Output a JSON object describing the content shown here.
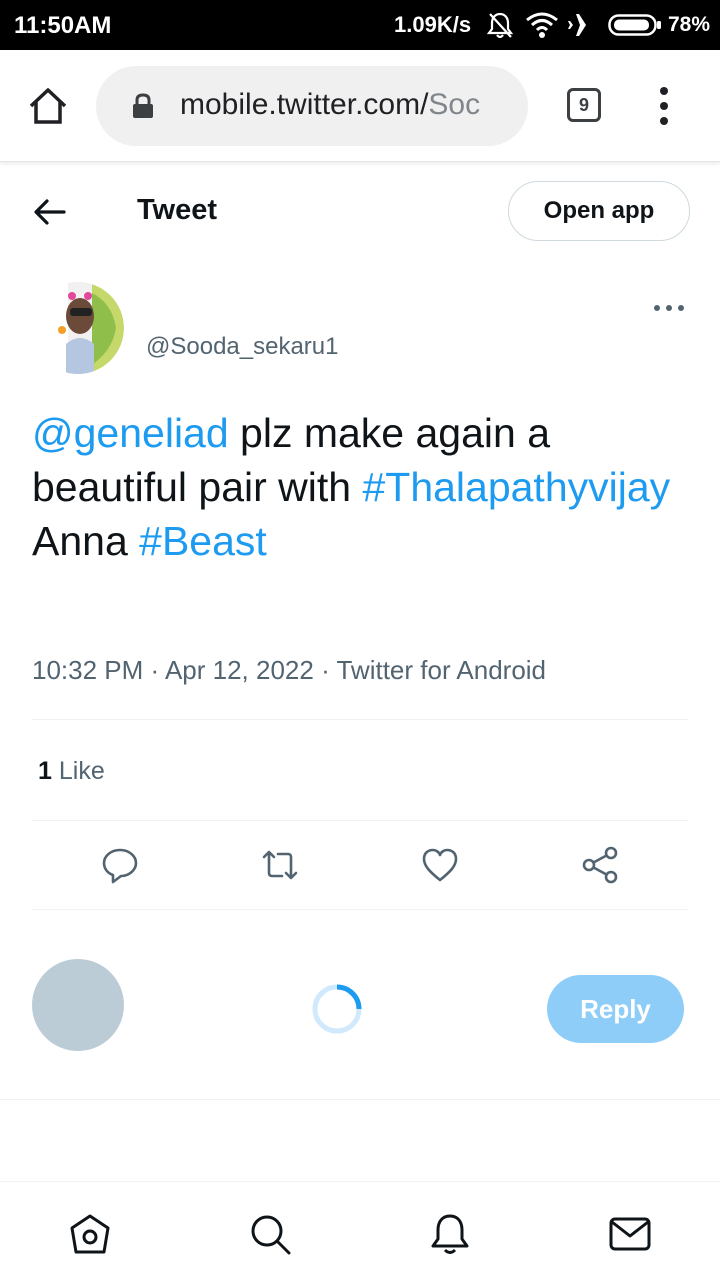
{
  "status_bar": {
    "time": "11:50AM",
    "net_speed": "1.09K/s",
    "battery": "78%",
    "icons": [
      "mute-icon",
      "wifi-icon",
      "airplane-icon",
      "battery-icon"
    ]
  },
  "browser": {
    "url_main": "mobile.twitter.com/",
    "url_tail": "Soc",
    "tab_count": "9",
    "icons": [
      "home-icon",
      "lock-icon",
      "more-vertical-icon"
    ]
  },
  "header": {
    "title": "Tweet",
    "open_app_label": "Open app"
  },
  "tweet": {
    "handle": "@Sooda_sekaru1",
    "text": {
      "mention": "@geneliad",
      "part1": " plz make again a beautiful pair with ",
      "hashtag1": "#Thalapathyvijay",
      "part2": " Anna ",
      "hashtag2": "#Beast"
    },
    "meta": "10:32 PM · Apr 12, 2022 · Twitter for Android",
    "like_count": "1",
    "like_label": "Like",
    "actions": [
      "reply-icon",
      "retweet-icon",
      "like-icon",
      "share-icon"
    ]
  },
  "composer": {
    "reply_label": "Reply"
  },
  "bottom_nav": {
    "items": [
      "home-icon",
      "search-icon",
      "notifications-icon",
      "messages-icon"
    ]
  },
  "colors": {
    "accent": "#1d9bf0",
    "reply_button": "#8ecdf8",
    "secondary_text": "#536471",
    "avatar_placeholder": "#bcccd6"
  }
}
